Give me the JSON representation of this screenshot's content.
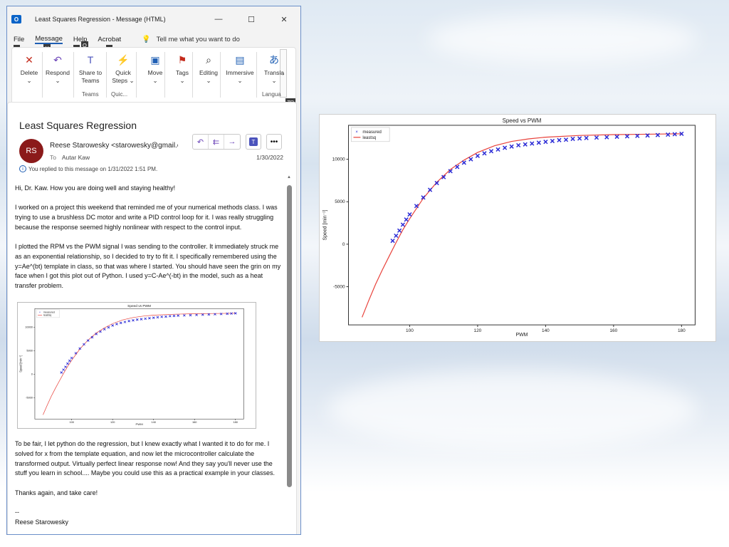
{
  "window": {
    "app_icon": "O",
    "title": "Least Squares Regression  -  Message (HTML)",
    "controls": [
      "—",
      "☐",
      "✕"
    ]
  },
  "menu": {
    "items": [
      {
        "label": "File",
        "keytip": "F"
      },
      {
        "label": "Message",
        "keytip": "H"
      },
      {
        "label": "Help",
        "keytip": "E"
      },
      {
        "label": "Acrobat",
        "keytip": "B"
      }
    ],
    "tell_me": "Tell me what you want to do",
    "tell_me_keytip": "Q"
  },
  "ribbon": {
    "buttons": [
      {
        "label": "Delete",
        "sub": "⌄",
        "icon": "delete-icon",
        "glyph": "✕",
        "color": "#c42b1c"
      },
      {
        "label": "Respond",
        "sub": "⌄",
        "icon": "respond-icon",
        "glyph": "↶",
        "color": "#6b44b8"
      },
      {
        "label": "Share to",
        "sub": "Teams",
        "icon": "teams-icon",
        "glyph": "T",
        "color": "#4b53bc"
      },
      {
        "label": "Quick",
        "sub": "Steps ⌄",
        "icon": "lightning-icon",
        "glyph": "⚡",
        "color": "#e8a317"
      },
      {
        "label": "Move",
        "sub": "⌄",
        "icon": "move-icon",
        "glyph": "▣",
        "color": "#1f5fb4"
      },
      {
        "label": "Tags",
        "sub": "⌄",
        "icon": "flag-icon",
        "glyph": "⚑",
        "color": "#c42b1c"
      },
      {
        "label": "Editing",
        "sub": "⌄",
        "icon": "search-icon",
        "glyph": "⌕",
        "color": "#333333"
      },
      {
        "label": "Immersive",
        "sub": "⌄",
        "icon": "immersive-reader-icon",
        "glyph": "▤",
        "color": "#1f5fb4"
      },
      {
        "label": "Transla",
        "sub": "⌄",
        "icon": "translate-icon",
        "glyph": "あ",
        "color": "#1f5fb4"
      }
    ],
    "groups": [
      "Teams",
      "Quic...",
      "Langua"
    ],
    "more": "›",
    "zr_keytip": "ZR"
  },
  "message": {
    "subject": "Least Squares Regression",
    "avatar_initials": "RS",
    "avatar_color": "#8b1a1a",
    "sender": "Reese Starowesky <starowesky@gmail.com>",
    "to_label": "To",
    "to": "Autar Kaw",
    "date": "1/30/2022",
    "replied_note": "You replied to this message on 1/31/2022 1:51 PM.",
    "actions": [
      "↶",
      "⇇",
      "→"
    ],
    "body": {
      "p1": "Hi, Dr. Kaw. How you are doing well and staying healthy!",
      "p2": "I worked on a project this weekend that reminded me of your numerical methods class. I was trying to use a brushless DC motor and write a PID control loop for it. I was really struggling because the response seemed highly nonlinear with respect to the control input.",
      "p3": "I plotted the RPM vs the PWM signal I was sending to the controller. It immediately struck me as an exponential relationship, so I decided to try to fit it. I specifically remembered using the y=Ae^(bt) template in class, so that was where I started. You should have seen the grin on my face when I got this plot out of Python. I used y=C-Ae^(-bt) in the model, such as a heat transfer problem.",
      "p4": "To be fair, I let python do the regression, but I knew exactly what I wanted it to do for me. I solved for x from the template equation, and now let the microcontroller calculate the transformed output. Virtually perfect linear response now! And they say you'll never use the stuff you learn in school....  Maybe you could use this as a practical example in your classes.",
      "p5": "Thanks again, and take care!",
      "sig_dash": "--",
      "sig_name": "Reese Starowesky"
    }
  },
  "chart_data": {
    "type": "scatter",
    "title": "Speed vs PWM",
    "xlabel": "PWM",
    "ylabel": "Speed [min⁻¹]",
    "xlim": [
      82,
      184
    ],
    "ylim": [
      -9500,
      14000
    ],
    "xticks": [
      100,
      120,
      140,
      160,
      180
    ],
    "yticks": [
      -5000,
      0,
      5000,
      10000
    ],
    "legend_position": "top-left",
    "series": [
      {
        "name": "measured",
        "marker": "x",
        "color": "#2b2bd6",
        "x": [
          95,
          96,
          97,
          98,
          99,
          100,
          102,
          104,
          106,
          108,
          110,
          112,
          114,
          116,
          118,
          120,
          122,
          124,
          126,
          128,
          130,
          132,
          134,
          136,
          138,
          140,
          142,
          144,
          146,
          148,
          150,
          152,
          155,
          158,
          161,
          164,
          167,
          170,
          173,
          176,
          178,
          180
        ],
        "y": [
          400,
          1000,
          1600,
          2300,
          2900,
          3500,
          4500,
          5500,
          6400,
          7200,
          7900,
          8600,
          9100,
          9600,
          10000,
          10400,
          10700,
          10950,
          11150,
          11350,
          11500,
          11650,
          11750,
          11850,
          11950,
          12050,
          12150,
          12250,
          12300,
          12400,
          12450,
          12500,
          12550,
          12600,
          12650,
          12700,
          12750,
          12800,
          12850,
          12900,
          12950,
          13000
        ]
      },
      {
        "name": "leastsq",
        "marker": "line",
        "color": "#e8413a",
        "x": [
          86,
          88,
          90,
          92,
          94,
          96,
          98,
          100,
          104,
          108,
          112,
          116,
          120,
          125,
          130,
          135,
          140,
          150,
          160,
          170,
          180
        ],
        "y": [
          -8600,
          -6600,
          -4700,
          -3000,
          -1400,
          200,
          1700,
          3000,
          5400,
          7300,
          8800,
          9900,
          10800,
          11600,
          12100,
          12400,
          12600,
          12800,
          12900,
          12950,
          13000
        ]
      }
    ]
  }
}
